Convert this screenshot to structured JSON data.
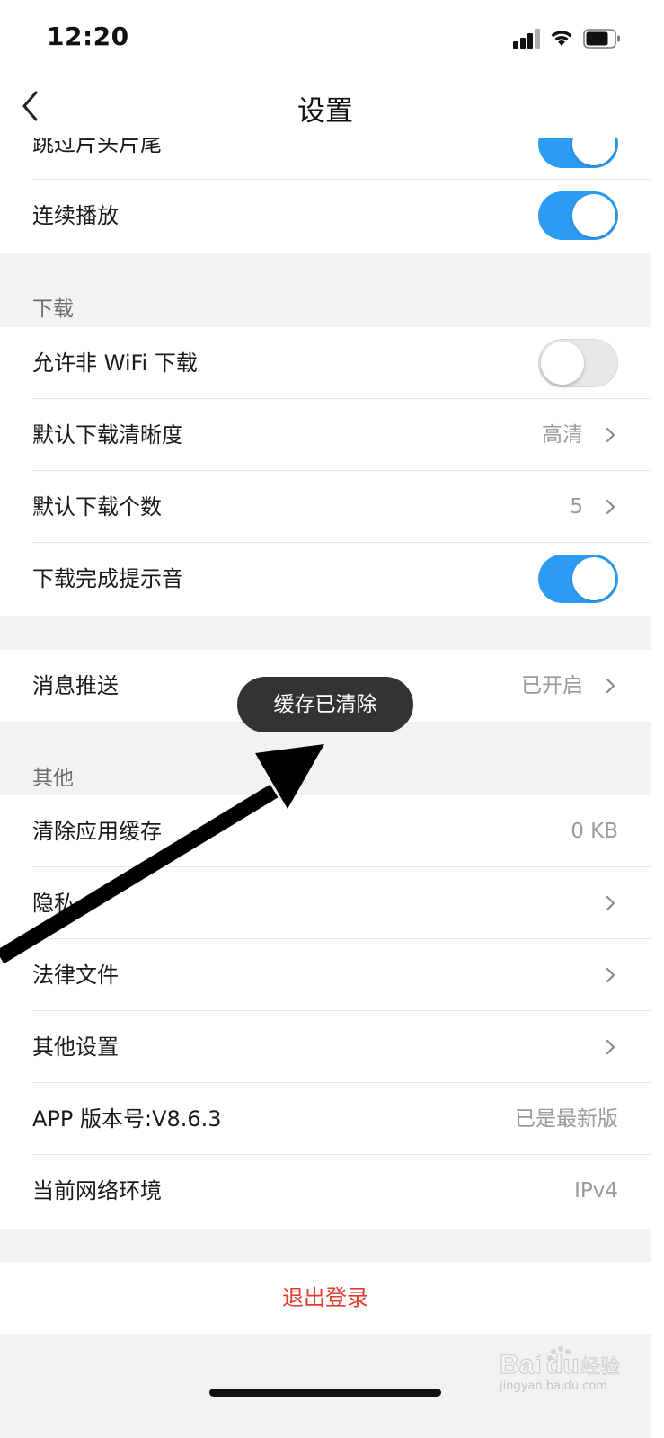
{
  "status_bar": {
    "time": "12:20"
  },
  "nav": {
    "title": "设置"
  },
  "playback": {
    "rows": [
      {
        "label": "跳过片头片尾",
        "toggle_on": true
      },
      {
        "label": "连续播放",
        "toggle_on": true
      }
    ]
  },
  "download": {
    "header": "下载",
    "rows": [
      {
        "label": "允许非 WiFi 下载",
        "toggle_on": false
      },
      {
        "label": "默认下载清晰度",
        "value": "高清"
      },
      {
        "label": "默认下载个数",
        "value": "5"
      },
      {
        "label": "下载完成提示音",
        "toggle_on": true
      }
    ]
  },
  "notifications": {
    "label": "消息推送",
    "value": "已开启"
  },
  "other": {
    "header": "其他",
    "rows": [
      {
        "label": "清除应用缓存",
        "value": "0 KB"
      },
      {
        "label": "隐私"
      },
      {
        "label": "法律文件"
      },
      {
        "label": "其他设置"
      },
      {
        "label": "APP 版本号:V8.6.3",
        "value": "已是最新版"
      },
      {
        "label": "当前网络环境",
        "value": "IPv4"
      }
    ]
  },
  "logout": {
    "label": "退出登录"
  },
  "toast": {
    "text": "缓存已清除"
  },
  "watermark": {
    "brand": "Baidu经验",
    "url": "jingyan.baidu.com"
  },
  "colors": {
    "accent": "#2c9bf2",
    "logout": "#e33b2e",
    "toast_bg": "#333333",
    "page_bg": "#f2f2f4"
  },
  "icons": [
    "back-chevron-icon",
    "signal-icon",
    "wifi-icon",
    "battery-icon",
    "chevron-right-icon"
  ]
}
